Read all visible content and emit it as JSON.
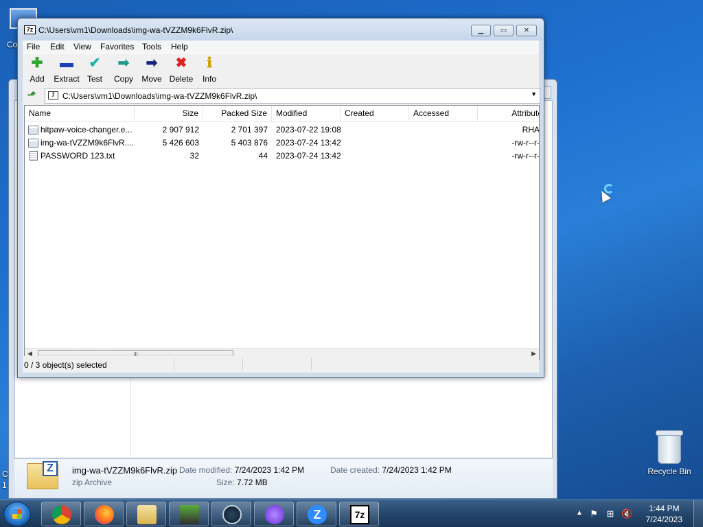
{
  "desktop": {
    "recycle_bin_label": "Recycle Bin",
    "left_labels": [
      "Co",
      "C",
      "1"
    ]
  },
  "explorer": {
    "details": {
      "file_name": "img-wa-tVZZM9k6FlvR.zip",
      "file_type": "zip Archive",
      "date_modified_label": "Date modified:",
      "date_modified": "7/24/2023 1:42 PM",
      "date_created_label": "Date created:",
      "date_created": "7/24/2023 1:42 PM",
      "size_label": "Size:",
      "size": "7.72 MB"
    }
  },
  "zip": {
    "title": "C:\\Users\\vm1\\Downloads\\img-wa-tVZZM9k6FlvR.zip\\",
    "app_icon_text": "7z",
    "menu": [
      "File",
      "Edit",
      "View",
      "Favorites",
      "Tools",
      "Help"
    ],
    "toolbar": [
      {
        "label": "Add",
        "icon": "plus-icon",
        "glyph": "✚",
        "color": "#2fa52f"
      },
      {
        "label": "Extract",
        "icon": "minus-icon",
        "glyph": "▬",
        "color": "#1f3fb8"
      },
      {
        "label": "Test",
        "icon": "check-arrow-icon",
        "glyph": "✔",
        "color": "#1fb3a0"
      },
      {
        "label": "Copy",
        "icon": "copy-arrow-icon",
        "glyph": "➡",
        "color": "#1f9a8a"
      },
      {
        "label": "Move",
        "icon": "move-arrow-icon",
        "glyph": "➡",
        "color": "#1a237e"
      },
      {
        "label": "Delete",
        "icon": "delete-x-icon",
        "glyph": "✖",
        "color": "#e01f1f"
      },
      {
        "label": "Info",
        "icon": "info-icon",
        "glyph": "ℹ",
        "color": "#c9a100"
      }
    ],
    "address": "C:\\Users\\vm1\\Downloads\\img-wa-tVZZM9k6FlvR.zip\\",
    "columns": [
      "Name",
      "Size",
      "Packed Size",
      "Modified",
      "Created",
      "Accessed",
      "Attribute"
    ],
    "rows": [
      {
        "name": "hitpaw-voice-changer.e...",
        "size": "2 907 912",
        "packed": "2 701 397",
        "modified": "2023-07-22 19:08",
        "created": "",
        "accessed": "",
        "attr": "RHA",
        "icon": "exe-file-icon"
      },
      {
        "name": "img-wa-tVZZM9k6FlvR....",
        "size": "5 426 603",
        "packed": "5 403 876",
        "modified": "2023-07-24 13:42",
        "created": "",
        "accessed": "",
        "attr": "-rw-r--r-",
        "icon": "exe-file-icon"
      },
      {
        "name": "PASSWORD 123.txt",
        "size": "32",
        "packed": "44",
        "modified": "2023-07-24 13:42",
        "created": "",
        "accessed": "",
        "attr": "-rw-r--r-",
        "icon": "text-file-icon"
      }
    ],
    "status": "0 / 3 object(s) selected"
  },
  "taskbar": {
    "apps": [
      "chrome-icon",
      "firefox-icon",
      "file-explorer-icon",
      "minecraft-icon",
      "steam-icon",
      "proton-vpn-icon",
      "zoom-icon",
      "7zip-icon"
    ],
    "time": "1:44 PM",
    "date": "7/24/2023"
  }
}
